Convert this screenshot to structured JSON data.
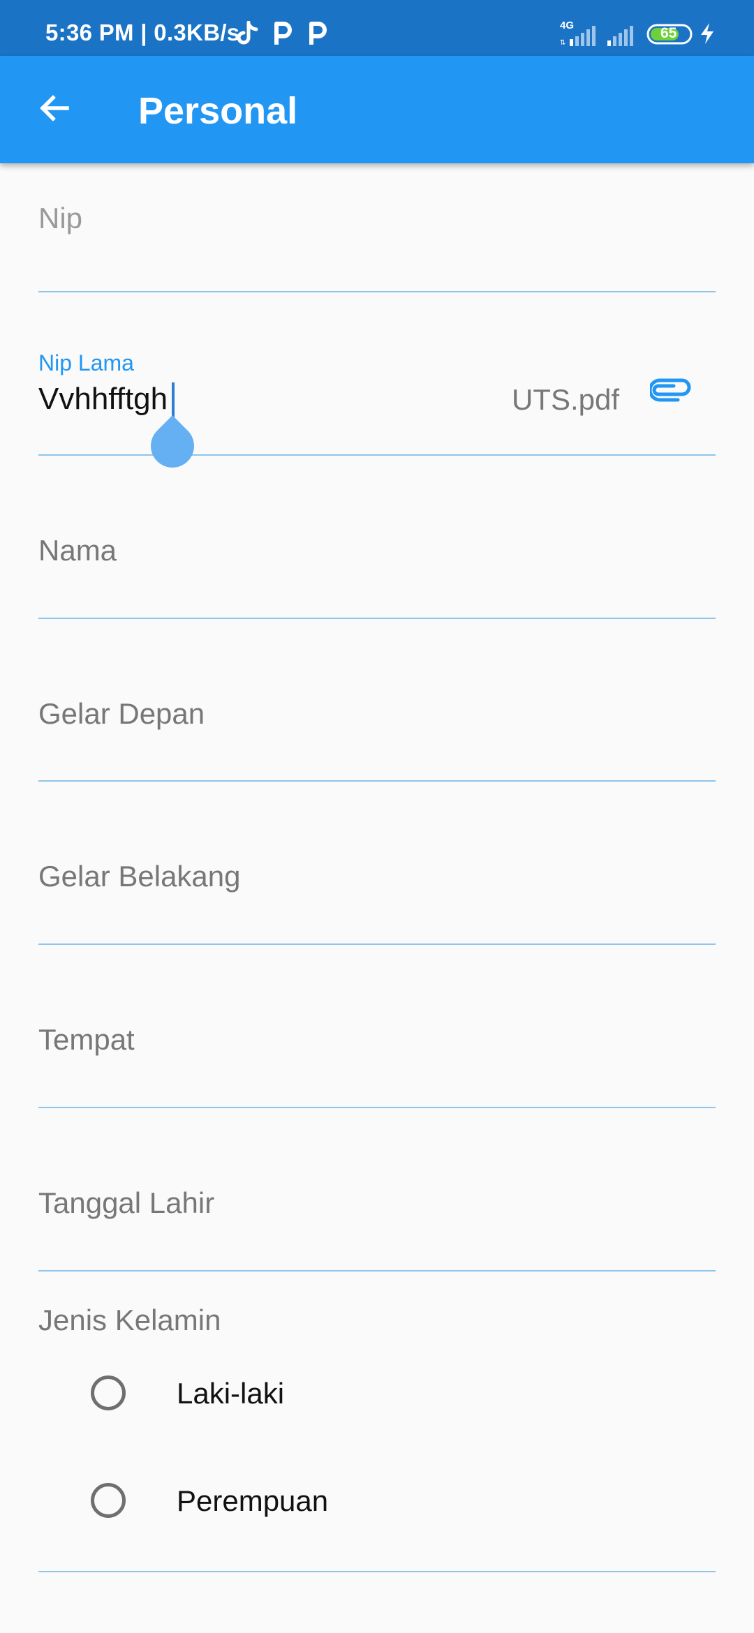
{
  "status_bar": {
    "time": "5:36 PM | 0.3KB/s",
    "network_type": "4G",
    "battery": "65",
    "icons": [
      "tiktok-icon",
      "p-app-icon",
      "p-app-icon",
      "signal-icon",
      "signal-icon",
      "battery-icon",
      "charging-icon"
    ]
  },
  "app_bar": {
    "back_icon": "arrow-left-icon",
    "title": "Personal"
  },
  "form": {
    "nip": {
      "label": "Nip",
      "value": ""
    },
    "nip_lama": {
      "label": "Nip Lama",
      "value": "Vvhhfftgh",
      "attachment": "UTS.pdf",
      "attach_icon": "paperclip-icon"
    },
    "nama": {
      "label": "Nama",
      "value": ""
    },
    "gelar_depan": {
      "label": "Gelar Depan",
      "value": ""
    },
    "gelar_belakang": {
      "label": "Gelar Belakang",
      "value": ""
    },
    "tempat": {
      "label": "Tempat",
      "value": ""
    },
    "tanggal_lahir": {
      "label": "Tanggal Lahir",
      "value": ""
    },
    "jenis_kelamin": {
      "label": "Jenis Kelamin",
      "options": [
        {
          "label": "Laki-laki",
          "selected": false
        },
        {
          "label": "Perempuan",
          "selected": false
        }
      ]
    }
  },
  "colors": {
    "status_bar": "#1a73c5",
    "app_bar": "#2196f3",
    "accent": "#2196f3",
    "underline": "#8ec5ec",
    "background": "#fafafa"
  }
}
